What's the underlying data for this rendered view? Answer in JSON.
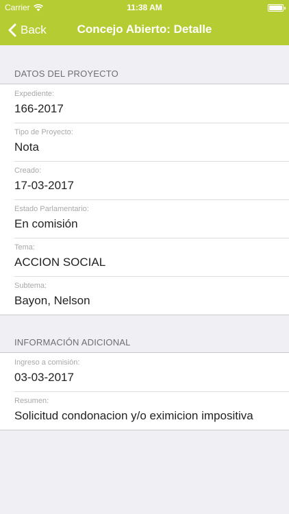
{
  "status_bar": {
    "carrier": "Carrier",
    "time": "11:38 AM"
  },
  "nav": {
    "back_label": "Back",
    "title": "Concejo Abierto: Detalle",
    "color": "#b5cc33"
  },
  "sections": [
    {
      "header": "DATOS DEL PROYECTO",
      "rows": [
        {
          "label": "Expediente:",
          "value": "166-2017"
        },
        {
          "label": "Tipo de Proyecto:",
          "value": "Nota"
        },
        {
          "label": "Creado:",
          "value": "17-03-2017"
        },
        {
          "label": "Estado Parlamentario:",
          "value": "En comisión"
        },
        {
          "label": "Tema:",
          "value": "ACCION SOCIAL"
        },
        {
          "label": "Subtema:",
          "value": "Bayon, Nelson"
        }
      ]
    },
    {
      "header": "INFORMACIÓN ADICIONAL",
      "rows": [
        {
          "label": "Ingreso a comisión:",
          "value": "03-03-2017"
        },
        {
          "label": "Resumen:",
          "value": "Solicitud condonacion y/o eximicion impositiva"
        }
      ]
    }
  ]
}
